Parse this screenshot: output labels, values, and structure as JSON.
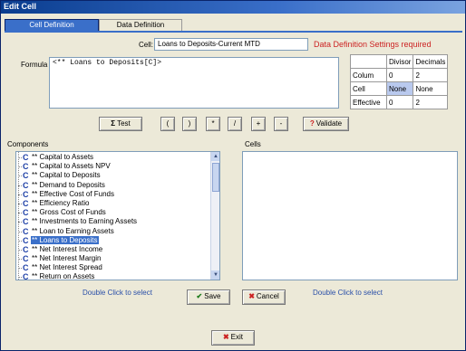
{
  "window": {
    "title": "Edit Cell"
  },
  "tabs": [
    {
      "label": "Cell Definition",
      "active": true
    },
    {
      "label": "Data Definition",
      "active": false
    }
  ],
  "cell": {
    "label": "Cell:",
    "value": "Loans to Deposits-Current MTD",
    "warning": "Data Definition Settings required"
  },
  "formula": {
    "label": "Formula",
    "value": "<** Loans to Deposits[C]>"
  },
  "data_def": {
    "headers": [
      "",
      "Divisor",
      "Decimals"
    ],
    "rows": [
      {
        "label": "Colum",
        "divisor": "0",
        "decimals": "2"
      },
      {
        "label": "Cell",
        "divisor": "None",
        "decimals": "None"
      },
      {
        "label": "Effective",
        "divisor": "0",
        "decimals": "2"
      }
    ]
  },
  "toolbar": {
    "test_label": "Test",
    "open_paren": "(",
    "close_paren": ")",
    "multiply": "*",
    "divide": "/",
    "plus": "+",
    "minus": "-",
    "validate_label": "Validate",
    "validate_icon": "?"
  },
  "components": {
    "label": "Components",
    "item_prefix": "C",
    "items": [
      "** Capital to Assets",
      "** Capital to Assets NPV",
      "** Capital to Deposits",
      "** Demand to Deposits",
      "** Effective Cost of Funds",
      "** Efficiency Ratio",
      "** Gross Cost of Funds",
      "** Investments to Earning Assets",
      "** Loan to Earning Assets",
      "** Loans to Deposits",
      "** Net Interest Income",
      "** Net Interest Margin",
      "** Net Interest Spread",
      "** Return on Assets"
    ],
    "selected_index": 9,
    "hint": "Double Click to select"
  },
  "cells": {
    "label": "Cells",
    "hint": "Double Click to select"
  },
  "buttons": {
    "save": "Save",
    "cancel": "Cancel",
    "exit": "Exit"
  }
}
